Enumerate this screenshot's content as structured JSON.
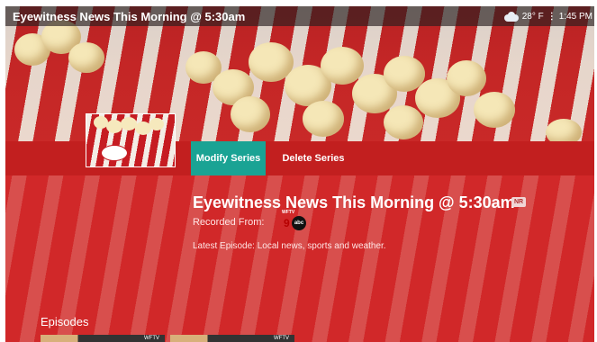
{
  "status_bar": {
    "title": "Eyewitness News This Morning @ 5:30am",
    "temperature": "28° F",
    "time": "1:45 PM",
    "weather_icon": "cloud-icon"
  },
  "actions": {
    "modify_label": "Modify Series",
    "delete_label": "Delete Series"
  },
  "details": {
    "title": "Eyewitness News This Morning @ 5:30am",
    "rating": "NR",
    "recorded_from_label": "Recorded From:",
    "station_small": "WFTV",
    "station_number": "9",
    "network": "abc",
    "description": "Latest Episode: Local news, sports and weather."
  },
  "episodes": {
    "heading": "Episodes",
    "items": [
      {
        "tag": "WFTV"
      },
      {
        "tag": "WFTV"
      }
    ]
  },
  "colors": {
    "accent": "#1aa394",
    "band": "#c21f1f",
    "overlay": "#d62c2c"
  }
}
